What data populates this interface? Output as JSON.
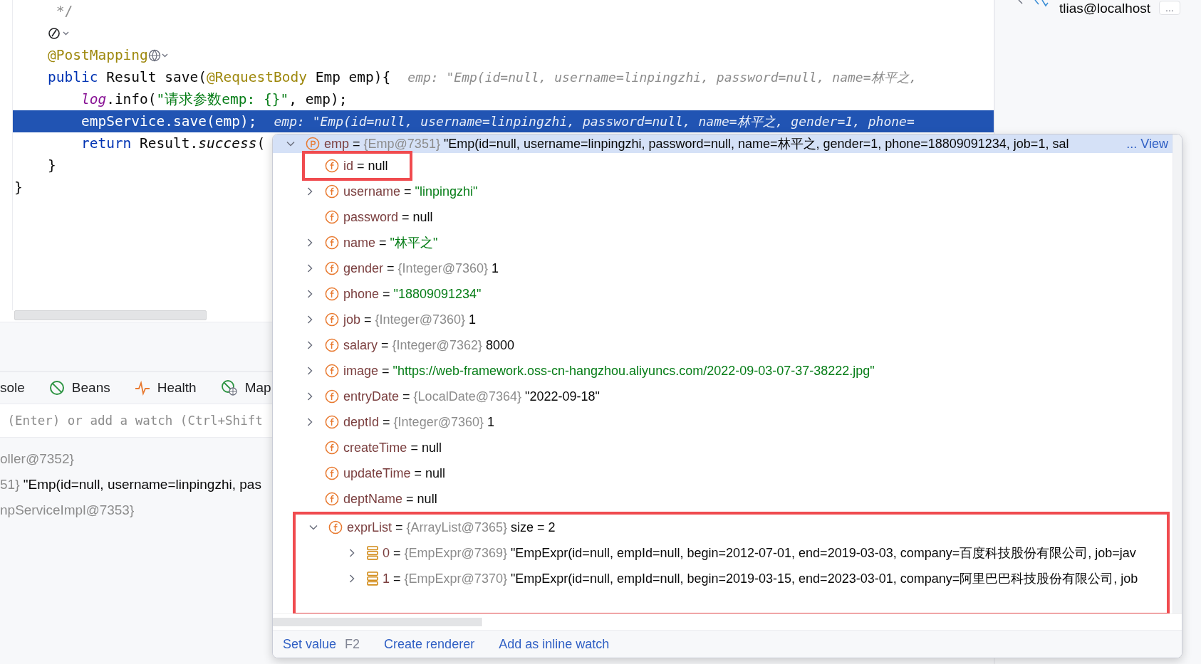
{
  "editor": {
    "lines": [
      {
        "kind": "code",
        "selected": false,
        "tokens": [
          {
            "kind": "comment",
            "text": "     */"
          }
        ]
      },
      {
        "kind": "icons",
        "selected": false
      },
      {
        "kind": "code",
        "selected": false,
        "globe": true,
        "tokens": [
          {
            "kind": "annotation",
            "text": "    @PostMapping"
          }
        ]
      },
      {
        "kind": "code",
        "selected": false,
        "tokens": [
          {
            "kind": "keyword",
            "text": "    public "
          },
          {
            "kind": "plain",
            "text": "Result save("
          },
          {
            "kind": "annotation",
            "text": "@RequestBody"
          },
          {
            "kind": "plain",
            "text": " Emp emp){"
          }
        ],
        "hint": "emp: \"Emp(id=null, username=linpingzhi, password=null, name=林平之, "
      },
      {
        "kind": "code",
        "selected": false,
        "tokens": [
          {
            "kind": "field",
            "text": "        log"
          },
          {
            "kind": "plain",
            "text": ".info("
          },
          {
            "kind": "string",
            "text": "\"请求参数emp: {}\""
          },
          {
            "kind": "plain",
            "text": ", emp);"
          }
        ]
      },
      {
        "kind": "code",
        "selected": true,
        "tokens": [
          {
            "kind": "plain",
            "text": "        empService.save(emp);"
          }
        ],
        "hint": "emp: \"Emp(id=null, username=linpingzhi, password=null, name=林平之, gender=1, phone="
      },
      {
        "kind": "code",
        "selected": false,
        "tokens": [
          {
            "kind": "keyword",
            "text": "        return "
          },
          {
            "kind": "plain",
            "text": "Result."
          },
          {
            "kind": "method",
            "text": "success"
          },
          {
            "kind": "plain",
            "text": "("
          }
        ]
      },
      {
        "kind": "code",
        "selected": false,
        "tokens": [
          {
            "kind": "plain",
            "text": "    }"
          }
        ]
      },
      {
        "kind": "code",
        "selected": false,
        "tokens": [
          {
            "kind": "plain",
            "text": "}"
          }
        ]
      }
    ]
  },
  "database": {
    "label": "tlias@localhost",
    "more": "..."
  },
  "tool_tabs": [
    {
      "kind": "plain",
      "label": "sole"
    },
    {
      "kind": "beans",
      "label": "Beans"
    },
    {
      "kind": "health",
      "label": "Health"
    },
    {
      "kind": "mappings",
      "label": "Map"
    }
  ],
  "watch": {
    "placeholder": " (Enter) or add a watch (Ctrl+Shift"
  },
  "variables": [
    {
      "ref": "oller@7352}"
    },
    {
      "ref": "51}",
      "value": "\"Emp(id=null, username=linpingzhi, pas"
    },
    {
      "ref": "npServiceImpl@7353}"
    }
  ],
  "popup": {
    "tree": {
      "kind": "param",
      "name": "emp",
      "sep": "=",
      "ref": "{Emp@7351}",
      "value": "\"Emp(id=null, username=linpingzhi, password=null, name=林平之, gender=1, phone=18809091234, job=1, sal",
      "quoted_string": false,
      "link": "... View",
      "expandable": true,
      "expanded": true,
      "selected": true,
      "marked": false,
      "children": [
        {
          "kind": "field",
          "name": "id",
          "sep": "=",
          "value": "null",
          "quoted_string": false,
          "expandable": false,
          "selected": false,
          "marked": true
        },
        {
          "kind": "field",
          "name": "username",
          "sep": "=",
          "value": "\"linpingzhi\"",
          "quoted_string": true,
          "expandable": true,
          "expanded": false,
          "selected": false,
          "marked": false
        },
        {
          "kind": "field",
          "name": "password",
          "sep": "=",
          "value": "null",
          "quoted_string": false,
          "expandable": false,
          "selected": false,
          "marked": false
        },
        {
          "kind": "field",
          "name": "name",
          "sep": "=",
          "value": "\"林平之\"",
          "quoted_string": true,
          "expandable": true,
          "expanded": false,
          "selected": false,
          "marked": false
        },
        {
          "kind": "field",
          "name": "gender",
          "sep": "=",
          "ref": "{Integer@7360}",
          "value": "1",
          "quoted_string": false,
          "expandable": true,
          "expanded": false,
          "selected": false,
          "marked": false
        },
        {
          "kind": "field",
          "name": "phone",
          "sep": "=",
          "value": "\"18809091234\"",
          "quoted_string": true,
          "expandable": true,
          "expanded": false,
          "selected": false,
          "marked": false
        },
        {
          "kind": "field",
          "name": "job",
          "sep": "=",
          "ref": "{Integer@7360}",
          "value": "1",
          "quoted_string": false,
          "expandable": true,
          "expanded": false,
          "selected": false,
          "marked": false
        },
        {
          "kind": "field",
          "name": "salary",
          "sep": "=",
          "ref": "{Integer@7362}",
          "value": "8000",
          "quoted_string": false,
          "expandable": true,
          "expanded": false,
          "selected": false,
          "marked": false
        },
        {
          "kind": "field",
          "name": "image",
          "sep": "=",
          "value": "\"https://web-framework.oss-cn-hangzhou.aliyuncs.com/2022-09-03-07-37-38222.jpg\"",
          "quoted_string": true,
          "expandable": true,
          "expanded": false,
          "selected": false,
          "marked": false
        },
        {
          "kind": "field",
          "name": "entryDate",
          "sep": "=",
          "ref": "{LocalDate@7364}",
          "value": "\"2022-09-18\"",
          "quoted_string": false,
          "expandable": true,
          "expanded": false,
          "selected": false,
          "marked": false
        },
        {
          "kind": "field",
          "name": "deptId",
          "sep": "=",
          "ref": "{Integer@7360}",
          "value": "1",
          "quoted_string": false,
          "expandable": true,
          "expanded": false,
          "selected": false,
          "marked": false
        },
        {
          "kind": "field",
          "name": "createTime",
          "sep": "=",
          "value": "null",
          "quoted_string": false,
          "expandable": false,
          "selected": false,
          "marked": false
        },
        {
          "kind": "field",
          "name": "updateTime",
          "sep": "=",
          "value": "null",
          "quoted_string": false,
          "expandable": false,
          "selected": false,
          "marked": false
        },
        {
          "kind": "field",
          "name": "deptName",
          "sep": "=",
          "value": "null",
          "quoted_string": false,
          "expandable": false,
          "selected": false,
          "marked": false
        },
        {
          "kind": "field",
          "name": "exprList",
          "sep": "=",
          "ref": "{ArrayList@7365}",
          "value": "size = 2",
          "quoted_string": false,
          "expandable": true,
          "expanded": true,
          "selected": false,
          "marked": true,
          "children": [
            {
              "kind": "element",
              "name": "0",
              "sep": "=",
              "ref": "{EmpExpr@7369}",
              "value": "\"EmpExpr(id=null, empId=null, begin=2012-07-01, end=2019-03-03, company=百度科技股份有限公司, job=jav",
              "quoted_string": false,
              "expandable": true,
              "expanded": false,
              "selected": false,
              "marked": false
            },
            {
              "kind": "element",
              "name": "1",
              "sep": "=",
              "ref": "{EmpExpr@7370}",
              "value": "\"EmpExpr(id=null, empId=null, begin=2019-03-15, end=2023-03-01, company=阿里巴巴科技股份有限公司, job",
              "quoted_string": false,
              "expandable": true,
              "expanded": false,
              "selected": false,
              "marked": false
            }
          ]
        }
      ]
    },
    "actions": [
      {
        "label": "Set value",
        "shortcut": "F2"
      },
      {
        "label": "Create renderer"
      },
      {
        "label": "Add as inline watch"
      }
    ]
  }
}
